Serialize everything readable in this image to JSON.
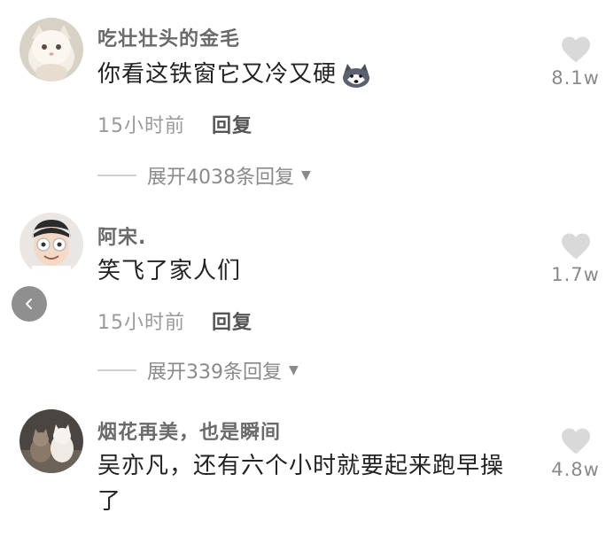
{
  "comments": [
    {
      "username": "吃壮壮头的金毛",
      "text": "你看这铁窗它又冷又硬",
      "emoji_icon": "husky-dog-emoji-icon",
      "time": "15小时前",
      "reply_label": "回复",
      "expand_label": "展开4038条回复",
      "likes": "8.1w"
    },
    {
      "username": "阿宋.",
      "text": "笑飞了家人们",
      "time": "15小时前",
      "reply_label": "回复",
      "expand_label": "展开339条回复",
      "likes": "1.7w"
    },
    {
      "username": "烟花再美，也是瞬间",
      "text": "吴亦凡，还有六个小时就要起来跑早操了",
      "likes": "4.8w"
    }
  ],
  "icons": {
    "like": "heart-icon",
    "expand": "caret-down-icon",
    "back": "chevron-left-icon"
  },
  "colors": {
    "username": "#6a6a6a",
    "content": "#222222",
    "meta": "#9a9a9a",
    "heart": "#d9d9d9"
  }
}
